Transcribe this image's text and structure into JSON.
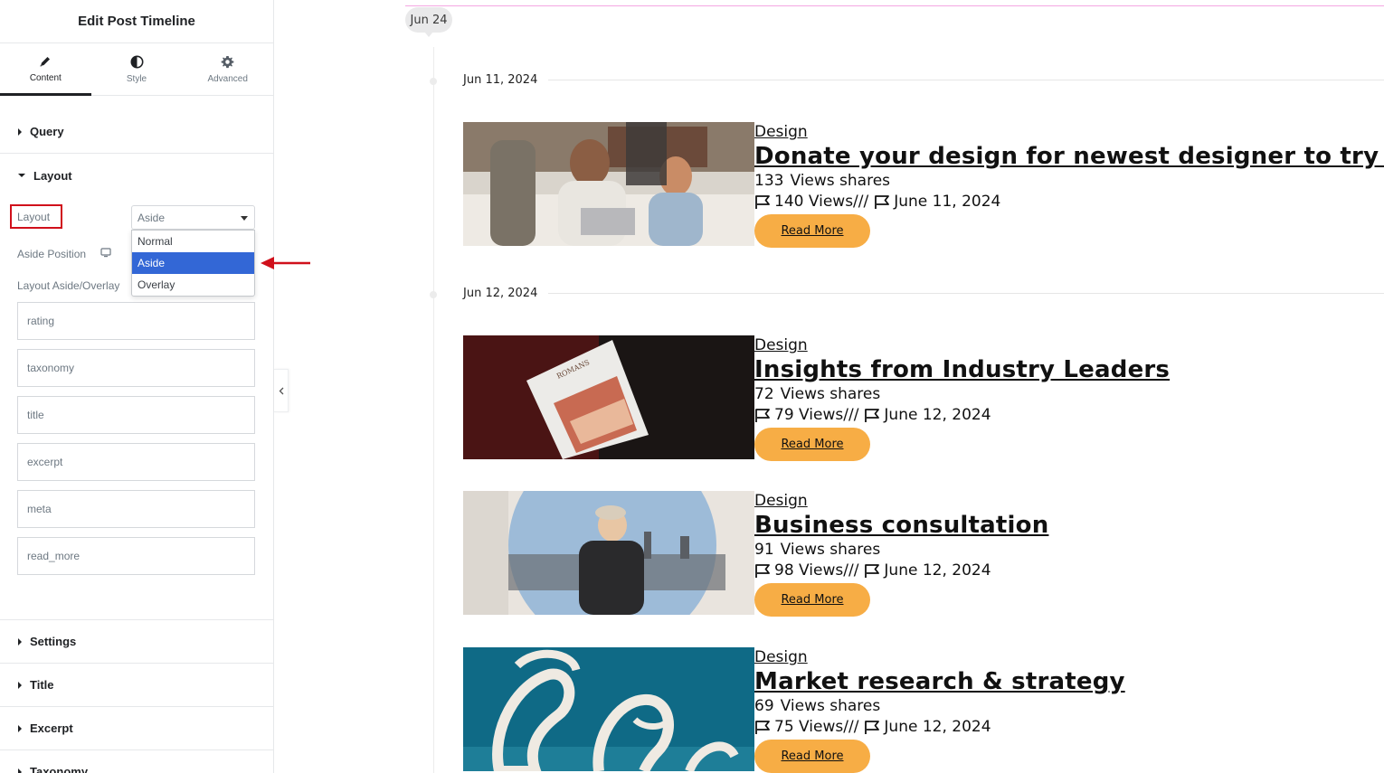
{
  "panel": {
    "title": "Edit Post Timeline",
    "tabs": [
      {
        "label": "Content",
        "icon": "pencil-icon"
      },
      {
        "label": "Style",
        "icon": "half-circle-icon"
      },
      {
        "label": "Advanced",
        "icon": "gear-icon"
      }
    ],
    "sections": {
      "query": "Query",
      "layout": "Layout",
      "settings": "Settings",
      "title": "Title",
      "excerpt": "Excerpt",
      "taxonomy": "Taxonomy"
    },
    "layout_control": {
      "label": "Layout",
      "selected": "Aside",
      "options": [
        "Normal",
        "Aside",
        "Overlay"
      ]
    },
    "aside_position_label": "Aside Position",
    "layout_aside_overlay_label": "Layout Aside/Overlay",
    "repeater_items": [
      "rating",
      "taxonomy",
      "title",
      "excerpt",
      "meta",
      "read_more"
    ]
  },
  "preview": {
    "month_label": "Jun 24",
    "accent_color": "#f7ad45",
    "posts": [
      {
        "date_label": "Jun 11, 2024",
        "category": "Design",
        "title": "Donate your design for newest designer to try better",
        "views_count": "133",
        "views_text": "Views shares",
        "meta_views": "140 Views///",
        "meta_date": "June 11, 2024",
        "read_more": "Read More"
      },
      {
        "date_label": "Jun 12, 2024",
        "category": "Design",
        "title": "Insights from Industry Leaders",
        "views_count": "72",
        "views_text": "Views shares",
        "meta_views": "79 Views///",
        "meta_date": "June 12, 2024",
        "read_more": "Read More"
      },
      {
        "category": "Design",
        "title": "Business consultation",
        "views_count": "91",
        "views_text": "Views shares",
        "meta_views": "98 Views///",
        "meta_date": "June 12, 2024",
        "read_more": "Read More"
      },
      {
        "category": "Design",
        "title": "Market research & strategy",
        "views_count": "69",
        "views_text": "Views shares",
        "meta_views": "75 Views///",
        "meta_date": "June 12, 2024",
        "read_more": "Read More"
      }
    ]
  }
}
